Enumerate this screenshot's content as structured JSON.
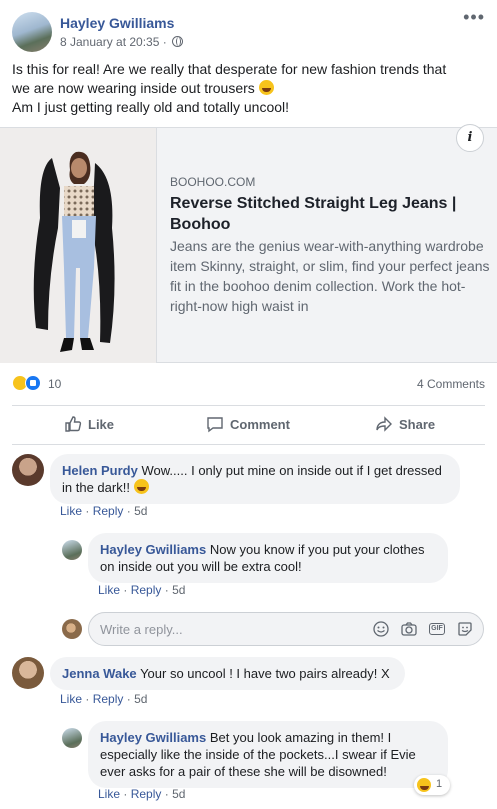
{
  "post": {
    "author": "Hayley Gwilliams",
    "date": "8 January at 20:35 ·",
    "text_lines": [
      "Is this for real! Are we really that desperate for new fashion trends that",
      "we are now wearing inside out trousers",
      "Am I just getting really old and totally uncool!"
    ]
  },
  "link": {
    "domain": "BOOHOO.COM",
    "title": "Reverse Stitched Straight Leg Jeans | Boohoo",
    "description": "Jeans are the genius wear-with-anything wardrobe item Skinny, straight, or slim, find your perfect jeans fit in the boohoo denim collection. Work the hot-right-now high waist in",
    "info_label": "i"
  },
  "stats": {
    "reactions": "10",
    "comments": "4 Comments"
  },
  "actions": {
    "like": "Like",
    "comment": "Comment",
    "share": "Share"
  },
  "comments": [
    {
      "name": "Helen Purdy",
      "text": "Wow..... I only put mine on inside out if I get dressed in the dark!!",
      "like": "Like",
      "reply": "Reply",
      "time": "5d"
    },
    {
      "name": "Hayley Gwilliams",
      "text": "Now you know if you put your clothes on inside out you will be extra cool!",
      "like": "Like",
      "reply": "Reply",
      "time": "5d"
    },
    {
      "name": "Jenna Wake",
      "text": "Your so uncool ! I have two pairs already! X",
      "like": "Like",
      "reply": "Reply",
      "time": "5d"
    },
    {
      "name": "Hayley Gwilliams",
      "text": "Bet you look amazing in them! I especially like the inside of the pockets...I swear if Evie ever asks for a pair of these she will be disowned!",
      "like": "Like",
      "reply": "Reply",
      "time": "5d",
      "reaction_count": "1"
    }
  ],
  "reply_box": {
    "placeholder": "Write a reply..."
  },
  "colors": {
    "link_blue": "#385898",
    "grey_text": "#606770",
    "bubble": "#f2f3f5",
    "like_blue": "#1877f2",
    "haha_yellow": "#f7c31c"
  }
}
